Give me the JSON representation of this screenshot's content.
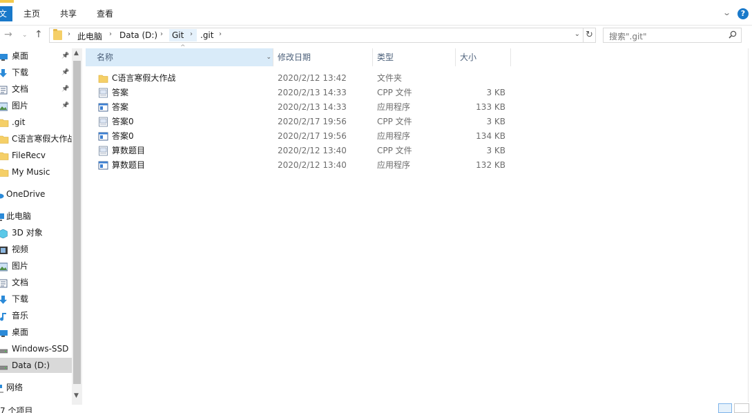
{
  "ribbon": {
    "file_tab": "文件",
    "tabs": [
      "主页",
      "共享",
      "查看"
    ]
  },
  "address": {
    "crumbs": [
      "此电脑",
      "Data (D:)",
      "Git",
      ".git"
    ]
  },
  "search": {
    "placeholder": "搜索\".git\""
  },
  "nav": {
    "items": [
      {
        "label": "桌面",
        "icon": "desktop-icon",
        "pinned": true
      },
      {
        "label": "下载",
        "icon": "download-icon",
        "pinned": true
      },
      {
        "label": "文档",
        "icon": "documents-icon",
        "pinned": true
      },
      {
        "label": "图片",
        "icon": "pictures-icon",
        "pinned": true
      },
      {
        "label": ".git",
        "icon": "folder-icon"
      },
      {
        "label": "C语言寒假大作战",
        "icon": "folder-icon"
      },
      {
        "label": "FileRecv",
        "icon": "folder-icon"
      },
      {
        "label": "My Music",
        "icon": "folder-icon"
      },
      {
        "label": "OneDrive",
        "icon": "cloud-icon"
      },
      {
        "label": "此电脑",
        "icon": "computer-icon"
      },
      {
        "label": "3D 对象",
        "icon": "3d-objects-icon"
      },
      {
        "label": "视频",
        "icon": "videos-icon"
      },
      {
        "label": "图片",
        "icon": "pictures-icon"
      },
      {
        "label": "文档",
        "icon": "documents-icon"
      },
      {
        "label": "下载",
        "icon": "download-icon"
      },
      {
        "label": "音乐",
        "icon": "music-icon"
      },
      {
        "label": "桌面",
        "icon": "desktop-icon"
      },
      {
        "label": "Windows-SSD",
        "icon": "drive-icon"
      },
      {
        "label": "Data (D:)",
        "icon": "drive-icon",
        "selected": true
      },
      {
        "label": "网络",
        "icon": "network-icon"
      }
    ]
  },
  "columns": [
    "名称",
    "修改日期",
    "类型",
    "大小"
  ],
  "files": [
    {
      "name": "C语言寒假大作战",
      "date": "2020/2/12 13:42",
      "type": "文件夹",
      "size": "",
      "icon": "folder-icon"
    },
    {
      "name": "答案",
      "date": "2020/2/13 14:33",
      "type": "CPP 文件",
      "size": "3 KB",
      "icon": "cpp-file-icon"
    },
    {
      "name": "答案",
      "date": "2020/2/13 14:33",
      "type": "应用程序",
      "size": "133 KB",
      "icon": "exe-file-icon"
    },
    {
      "name": "答案0",
      "date": "2020/2/17 19:56",
      "type": "CPP 文件",
      "size": "3 KB",
      "icon": "cpp-file-icon"
    },
    {
      "name": "答案0",
      "date": "2020/2/17 19:56",
      "type": "应用程序",
      "size": "134 KB",
      "icon": "exe-file-icon"
    },
    {
      "name": "算数题目",
      "date": "2020/2/12 13:40",
      "type": "CPP 文件",
      "size": "3 KB",
      "icon": "cpp-file-icon"
    },
    {
      "name": "算数题目",
      "date": "2020/2/12 13:40",
      "type": "应用程序",
      "size": "132 KB",
      "icon": "exe-file-icon"
    }
  ],
  "status": {
    "text": "7 个项目"
  },
  "colors": {
    "accent": "#1979ca",
    "selection": "#cce8ff",
    "folder": "#f5cf67"
  }
}
